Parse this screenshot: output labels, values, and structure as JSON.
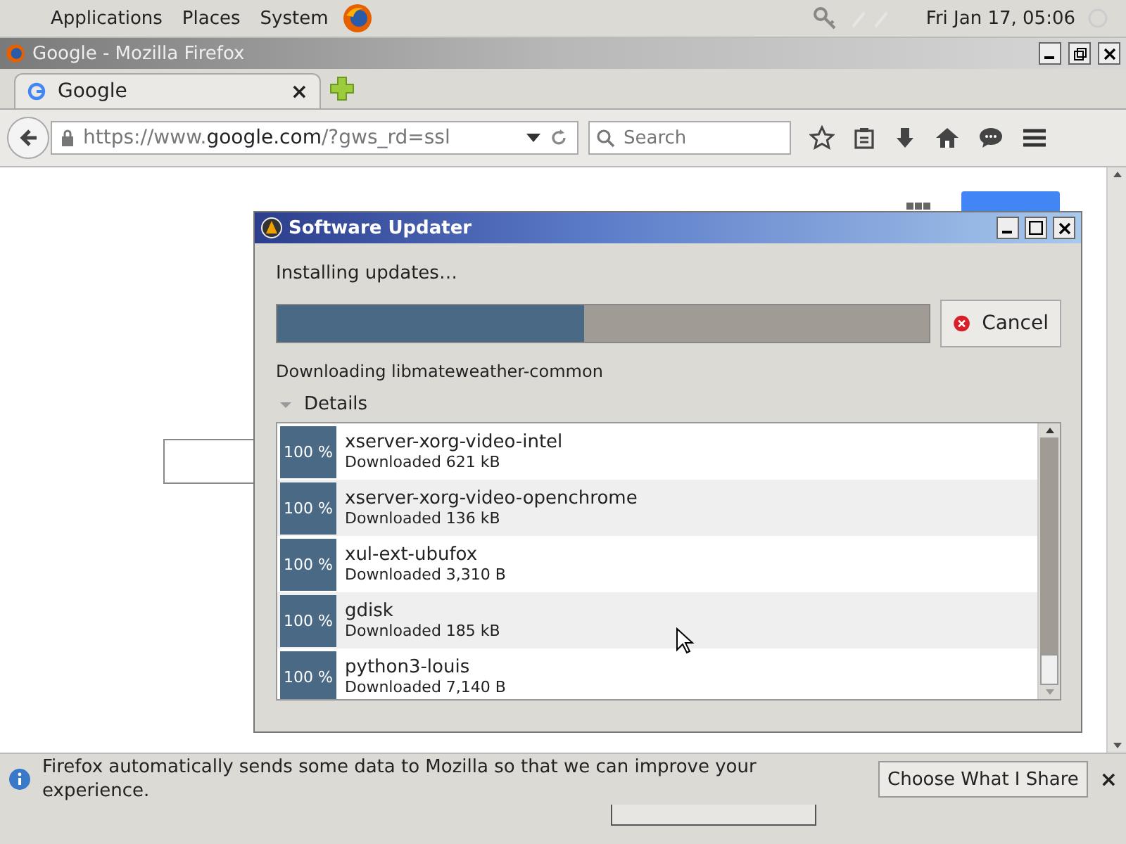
{
  "top_panel": {
    "menus": [
      "Applications",
      "Places",
      "System"
    ],
    "clock": "Fri Jan 17, 05:06"
  },
  "window": {
    "title": "Google - Mozilla Firefox"
  },
  "tabs": [
    {
      "label": "Google",
      "selected": true,
      "close": "×"
    }
  ],
  "nav": {
    "url_host": "https://www.**google.com**/?gws_rd=ssl",
    "search": {
      "placeholder": "Search"
    }
  },
  "dialog": {
    "title": "Software Updater",
    "status": "Installing updates…",
    "level": 0.47,
    "cancel": "Cancel",
    "activity": "Downloading libmateweather-common",
    "details": {
      "label": "Details",
      "expanded": true
    },
    "packages": [
      {
        "percent": "100 %",
        "name": "xserver-xorg-video-intel",
        "size": "Downloaded 621 kB"
      },
      {
        "percent": "100 %",
        "name": "xserver-xorg-video-openchrome",
        "size": "Downloaded 136 kB"
      },
      {
        "percent": "100 %",
        "name": "xul-ext-ubufox",
        "size": "Downloaded 3,310 B"
      },
      {
        "percent": "100 %",
        "name": "gdisk",
        "size": "Downloaded 185 kB"
      },
      {
        "percent": "100 %",
        "name": "python3-louis",
        "size": "Downloaded 7,140 B"
      }
    ]
  },
  "notification": {
    "text": "Firefox automatically sends some data to Mozilla so that we can improve your experience.",
    "button": "Choose What I Share",
    "close": "×"
  }
}
